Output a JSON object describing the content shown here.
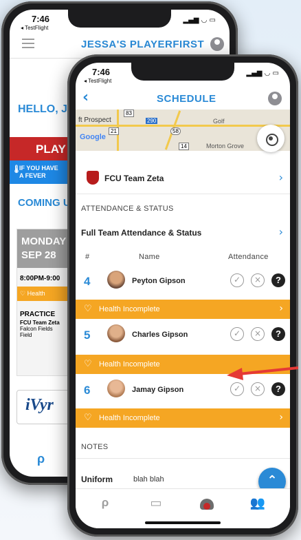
{
  "back_screen": {
    "time": "7:46",
    "testflight": "◂ TestFlight",
    "title": "JESSA'S PLAYERFIRST",
    "hello": "HELLO, JE",
    "play_banner": "PLAY S",
    "fever_line1": "IF YOU HAVE",
    "fever_line2": "A FEVER",
    "coming_up": "COMING UP",
    "card": {
      "day": "MONDAY",
      "date": "SEP 28",
      "time": "8:00PM-9:00",
      "health": "Health",
      "type": "PRACTICE",
      "team": "FCU Team Zeta",
      "location1": "Falcon Fields",
      "location2": "Field"
    },
    "logo_text": "iVyr",
    "colors": {
      "accent": "#2a8ad6",
      "banner_red": "#c62828",
      "fever_blue": "#1e88e5"
    }
  },
  "front_screen": {
    "time": "7:46",
    "testflight": "◂ TestFlight",
    "title": "SCHEDULE",
    "map": {
      "place1": "ft Prospect",
      "place2": "Golf",
      "place3": "Morton Grove",
      "google": "Google",
      "road_badges": [
        "83",
        "290",
        "21",
        "58",
        "14"
      ]
    },
    "team_name": "FCU Team Zeta",
    "section_attendance": "ATTENDANCE & STATUS",
    "full_team_link": "Full Team Attendance & Status",
    "table_headers": {
      "num": "#",
      "name": "Name",
      "attendance": "Attendance"
    },
    "players": [
      {
        "number": "4",
        "name": "Peyton Gipson",
        "health": "Health Incomplete"
      },
      {
        "number": "5",
        "name": "Charles Gipson",
        "health": "Health Incomplete"
      },
      {
        "number": "6",
        "name": "Jamay Gipson",
        "health": "Health Incomplete"
      }
    ],
    "section_notes": "NOTES",
    "notes": {
      "label": "Uniform",
      "value": "blah blah"
    },
    "icons": {
      "back": "chevron-left-icon",
      "profile": "user-circle-icon",
      "locate": "locate-icon",
      "scroll_top": "chevron-up-icon",
      "tabs": [
        "playerfirst-logo-icon",
        "calendar-icon",
        "health-icon",
        "team-icon"
      ]
    },
    "colors": {
      "accent": "#2a8ad6",
      "health_bar": "#f5a623",
      "fab": "#2a8ad6",
      "annotation_arrow": "#e53935"
    }
  }
}
